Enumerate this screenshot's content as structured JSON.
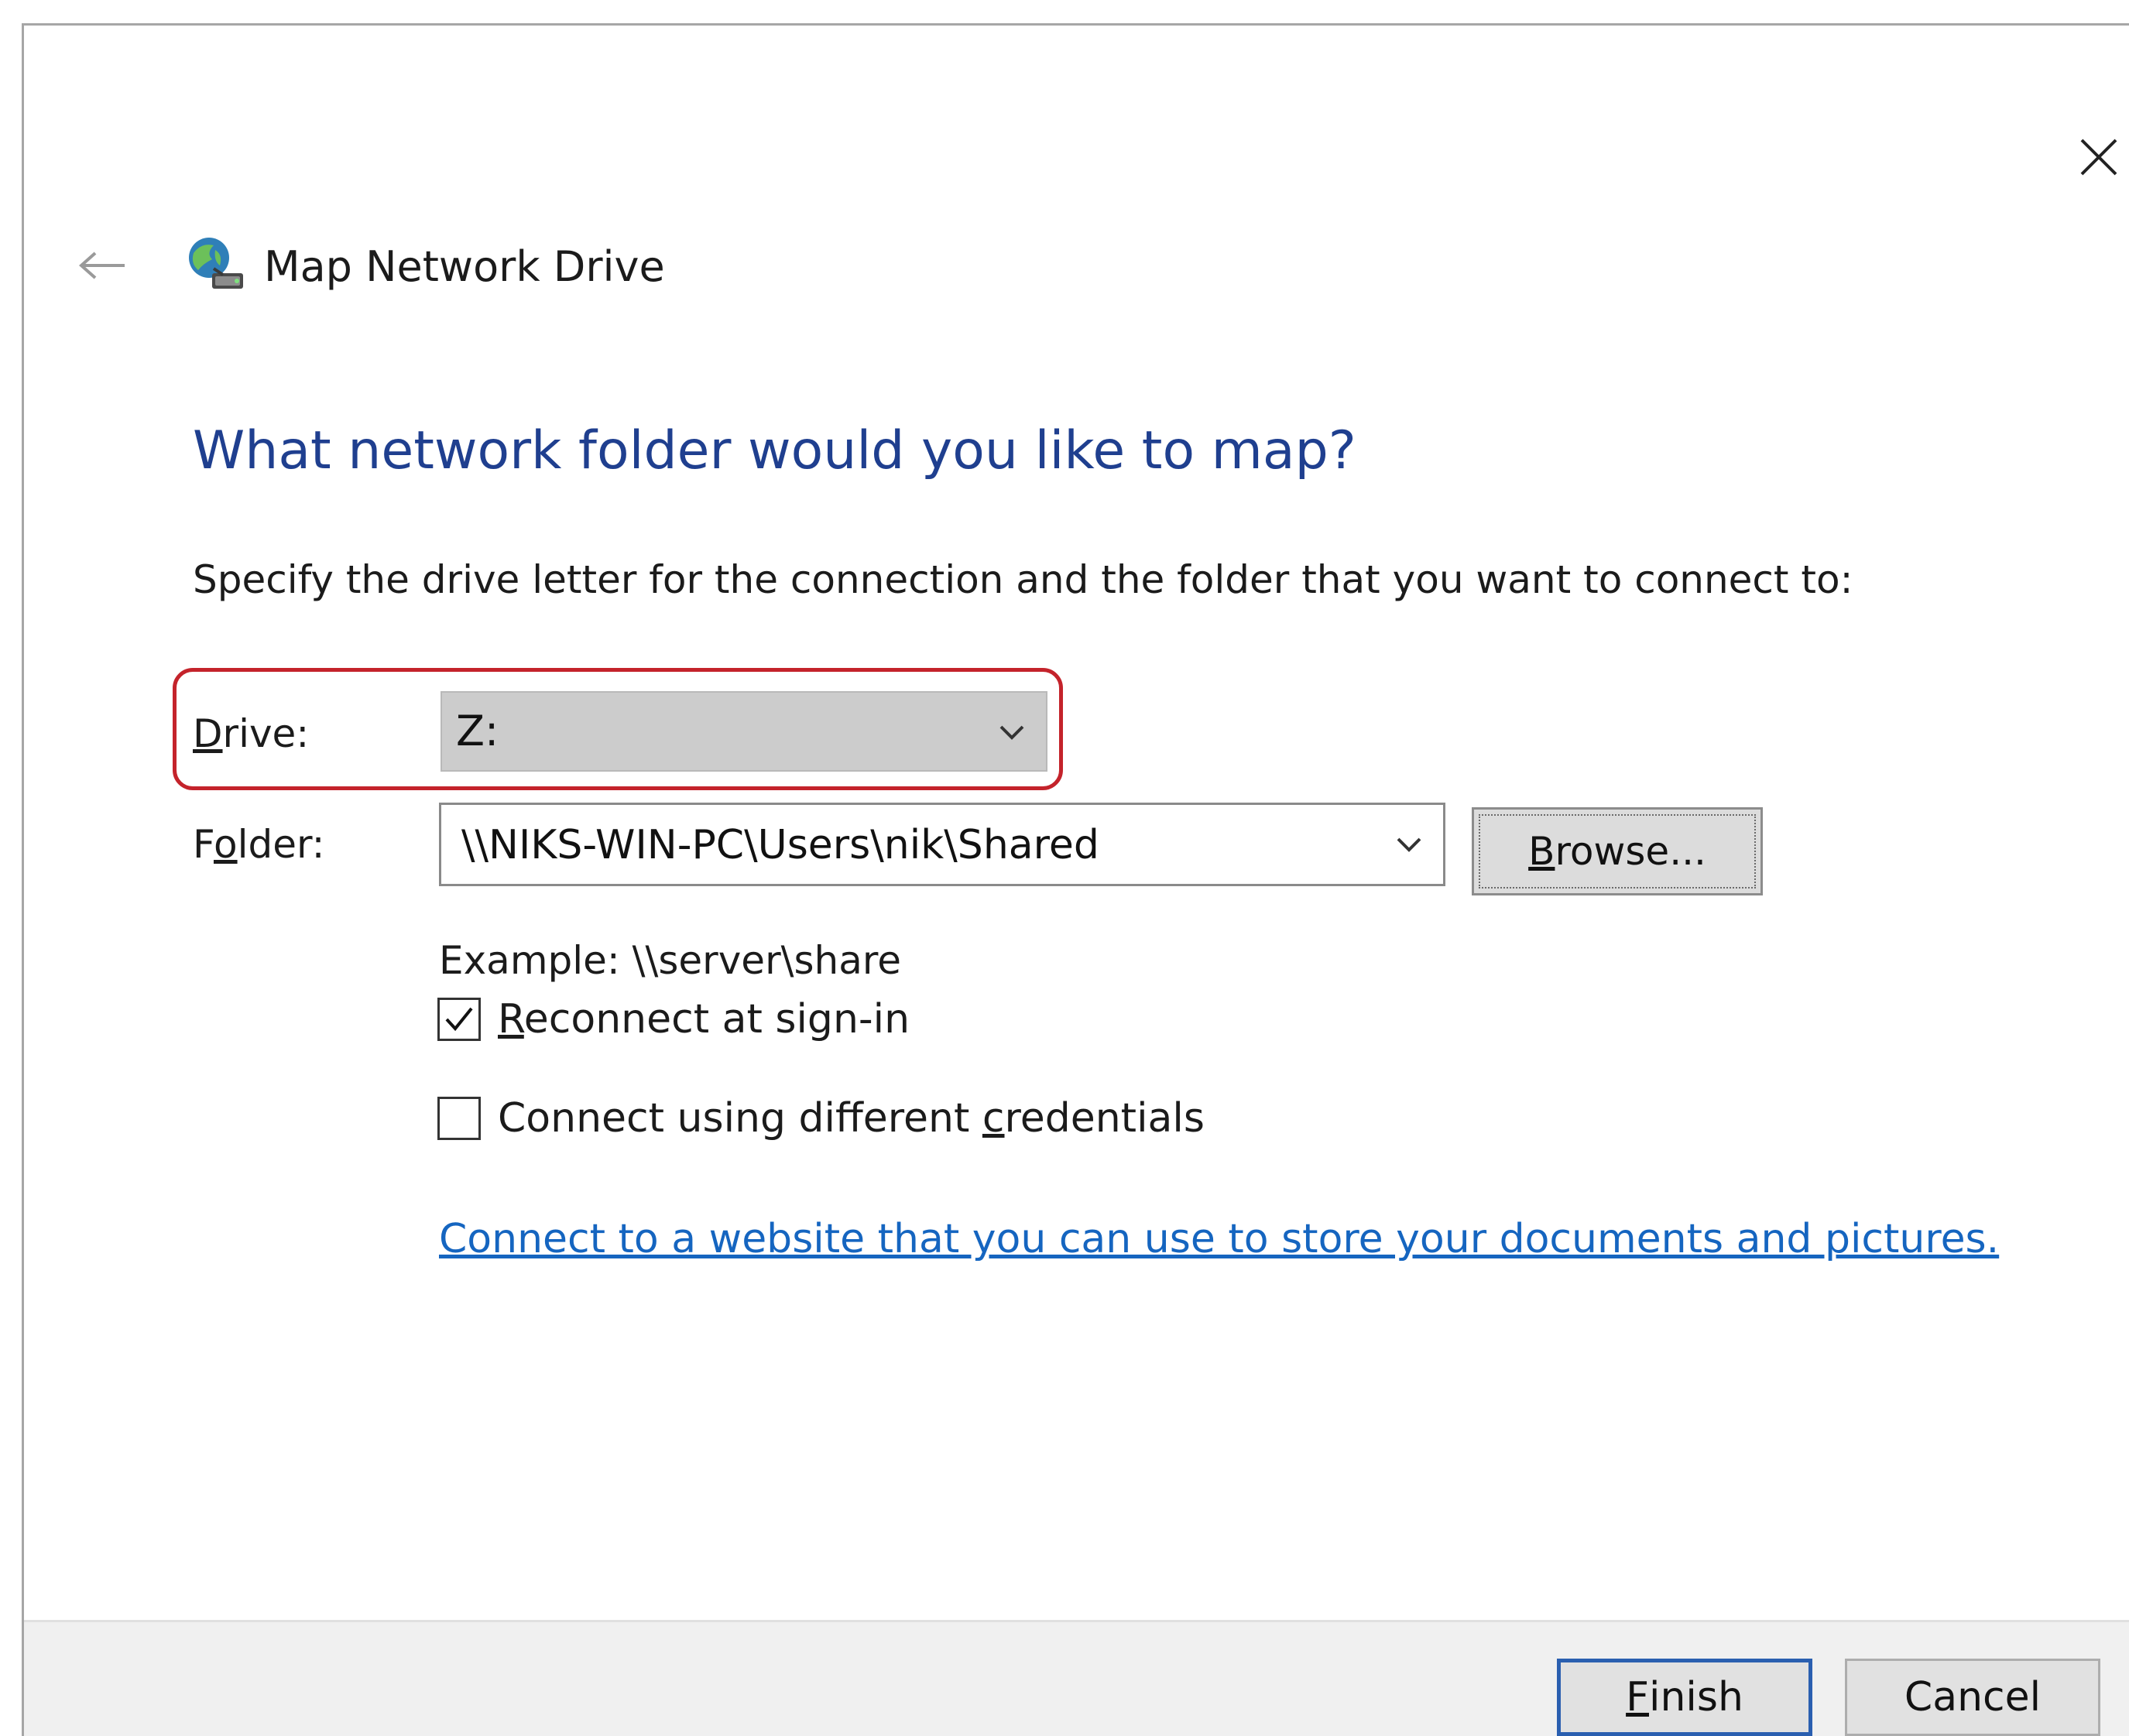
{
  "window": {
    "title": "Map Network Drive",
    "icons": {
      "close": "close-icon",
      "back": "back-arrow-icon",
      "title": "network-drive-icon"
    }
  },
  "page": {
    "heading": "What network folder would you like to map?",
    "instruction": "Specify the drive letter for the connection and the folder that you want to connect to:"
  },
  "drive": {
    "label_mnemonic": "D",
    "label_rest": "rive:",
    "value": "Z:"
  },
  "folder": {
    "label_pre": "F",
    "label_mnemonic": "o",
    "label_rest": "lder:",
    "value": "\\\\NIKS-WIN-PC\\Users\\nik\\Shared"
  },
  "browse": {
    "mnemonic": "B",
    "rest": "rowse..."
  },
  "example": "Example: \\\\server\\share",
  "options": [
    {
      "mnemonic": "R",
      "rest": "econnect at sign-in",
      "checked": true
    },
    {
      "pre": "Connect using different ",
      "mnemonic": "c",
      "rest": "redentials",
      "checked": false
    }
  ],
  "link": "Connect to a website that you can use to store your documents and pictures.",
  "buttons": {
    "finish_mnemonic": "F",
    "finish_rest": "inish",
    "cancel": "Cancel"
  },
  "colors": {
    "heading": "#1f3f8f",
    "link": "#1565c0",
    "highlight": "#c4232b",
    "default_button_border": "#2a5fb0"
  }
}
